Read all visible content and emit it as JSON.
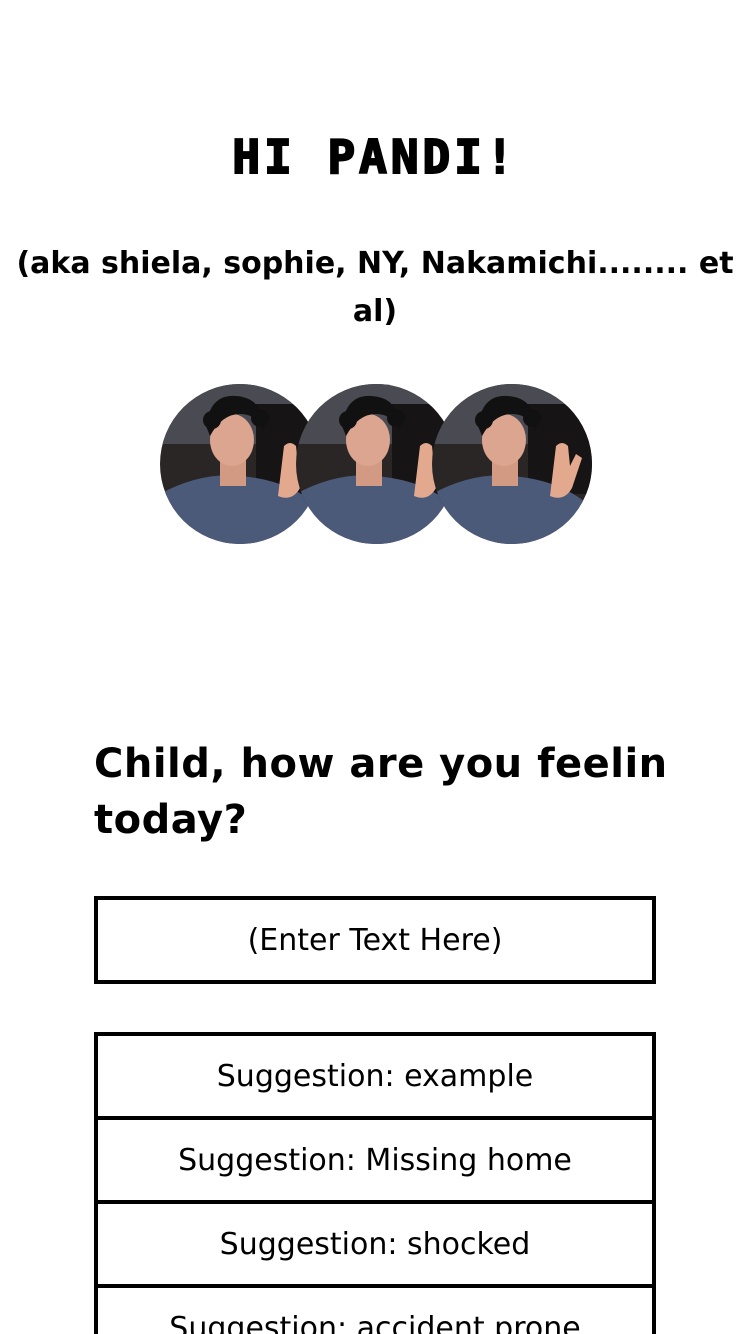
{
  "header": {
    "greeting": "HI PANDI!",
    "aka": "(aka shiela, sophie, NY, Nakamichi........ et al)"
  },
  "avatars": [
    {
      "name": "profile-photo"
    },
    {
      "name": "profile-photo"
    },
    {
      "name": "profile-photo"
    }
  ],
  "prompt": {
    "question": "Child, how are you feelin today?",
    "input_placeholder": "(Enter Text Here)",
    "input_value": ""
  },
  "suggestions": [
    {
      "label": "Suggestion: example"
    },
    {
      "label": "Suggestion: Missing home"
    },
    {
      "label": "Suggestion: shocked"
    },
    {
      "label": "Suggestion: accident prone"
    }
  ],
  "colors": {
    "background": "#ffffff",
    "text": "#000000",
    "border": "#000000"
  }
}
